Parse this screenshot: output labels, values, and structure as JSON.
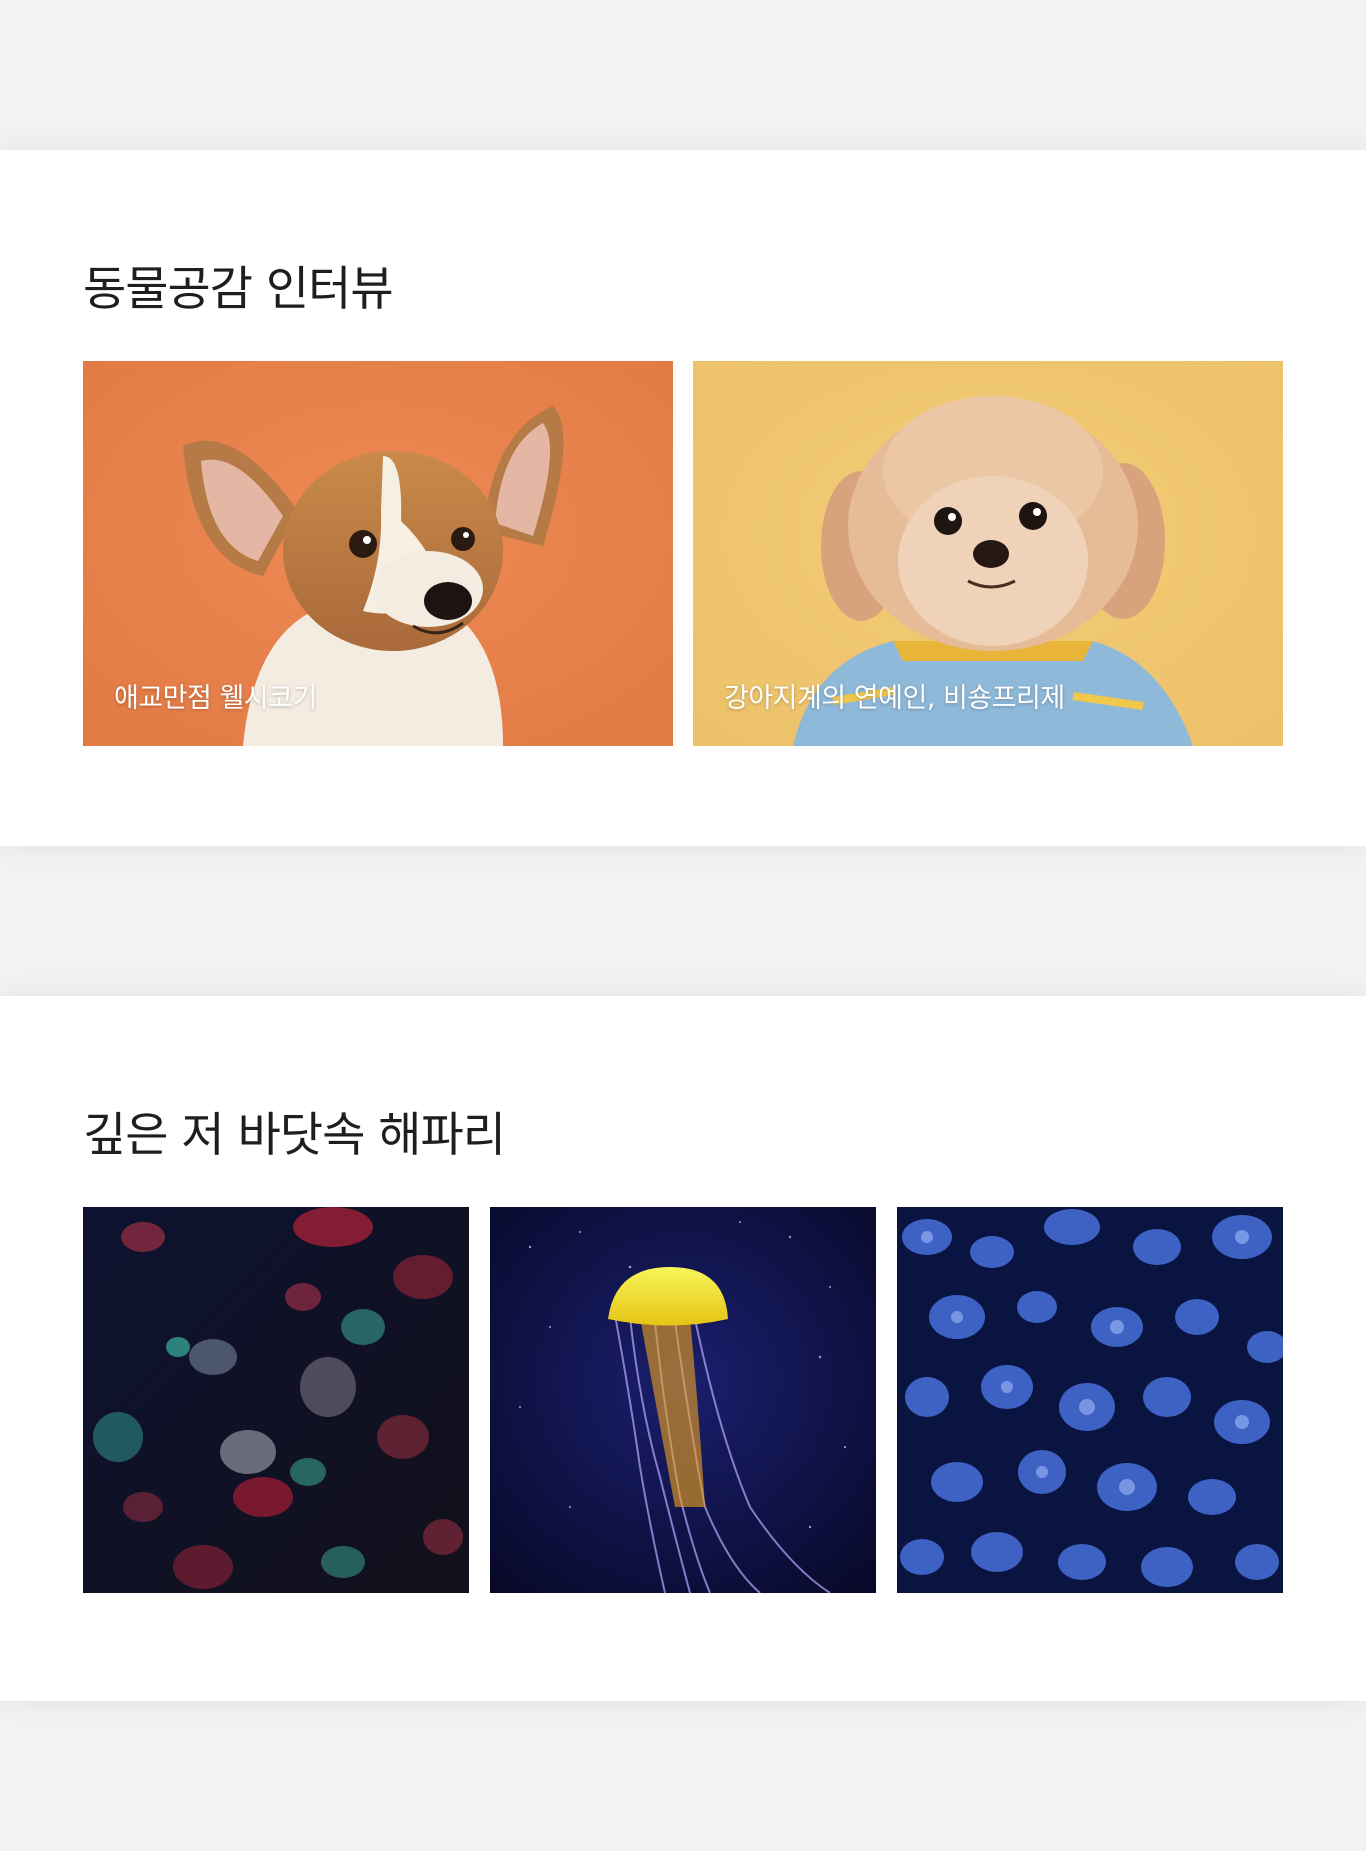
{
  "interview_section": {
    "title": "동물공감 인터뷰",
    "cards": [
      {
        "caption": "애교만점 웰시코기",
        "image": "welsh-corgi-photo",
        "bg_color": "#e8824e"
      },
      {
        "caption": "강아지계의 연예인, 비숑프리제",
        "image": "bichon-frise-photo",
        "bg_color": "#efc66e"
      }
    ]
  },
  "jellyfish_section": {
    "title": "깊은 저 바닷속 해파리",
    "cards": [
      {
        "image": "red-jellyfish-photo"
      },
      {
        "image": "yellow-jellyfish-photo"
      },
      {
        "image": "blue-jellyfish-photo"
      }
    ]
  }
}
